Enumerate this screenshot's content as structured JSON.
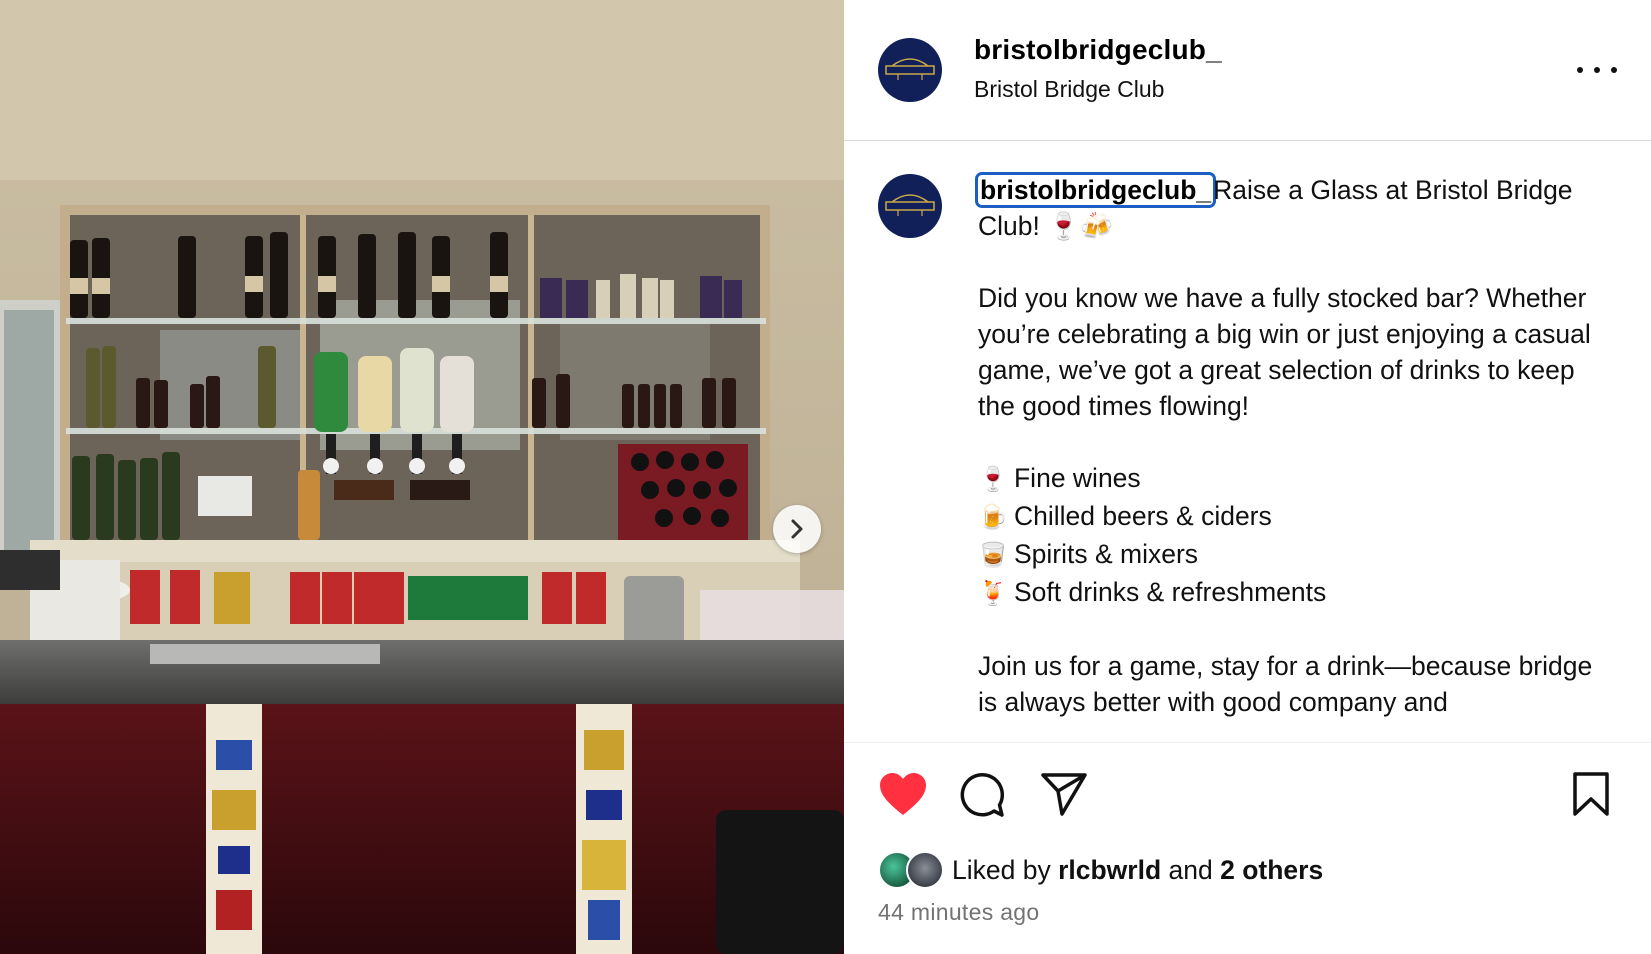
{
  "post": {
    "username": "bristolbridgeclub_",
    "full_name": "Bristol Bridge Club",
    "caption_title": "Raise a Glass at Bristol Bridge Club! 🍷🍻",
    "caption_para1": "Did you know we have a fully stocked bar? Whether you’re celebrating a big win or just enjoying a casual game, we’ve got a great selection of drinks to keep the good times flowing!",
    "caption_list": [
      {
        "emoji": "🍷",
        "text": "Fine wines"
      },
      {
        "emoji": "🍺",
        "text": "Chilled beers & ciders"
      },
      {
        "emoji": "🥃",
        "text": "Spirits & mixers"
      },
      {
        "emoji": "🍹",
        "text": "Soft drinks & refreshments"
      }
    ],
    "caption_para2": "Join us for a game, stay for a drink—because bridge is always better with good company and"
  },
  "likes": {
    "prefix": "Liked by",
    "first_liker": "rlcbwrld",
    "middle": "and",
    "others": "2 others"
  },
  "timestamp": "44 minutes ago",
  "icons": {
    "like": "heart-filled-icon",
    "comment": "comment-icon",
    "share": "send-icon",
    "save": "bookmark-icon",
    "more": "more-options-icon",
    "next": "chevron-right-icon"
  },
  "colors": {
    "like_red": "#ff3040",
    "focus_outline": "#1c5fc4",
    "avatar_navy": "#12205a",
    "muted_text": "#737373"
  }
}
